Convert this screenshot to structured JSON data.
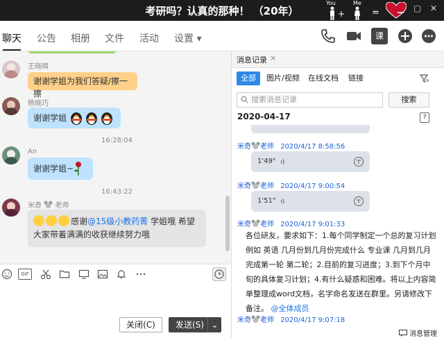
{
  "titlebar": {
    "title": "考研吗？认真的那种！ （20年）",
    "fig_you": "You",
    "fig_me": "Me",
    "plus": "+",
    "equals": "="
  },
  "tabs": [
    {
      "label": "聊天"
    },
    {
      "label": "公告"
    },
    {
      "label": "相册"
    },
    {
      "label": "文件"
    },
    {
      "label": "活动"
    },
    {
      "label": "设置 ▾"
    }
  ],
  "toolbar": {
    "course_label": "课"
  },
  "chat": {
    "messages": [
      {
        "sender": "王晓晴",
        "text": "谢谢学姐为我们答疑/擦一擦"
      },
      {
        "sender": "杨晓巧",
        "text": "谢谢学姐"
      },
      {
        "sender": "An",
        "text": "谢谢学姐~"
      },
      {
        "sender": "米奇",
        "sender_suffix": "老师",
        "text_prefix": "感谢",
        "mention": "@15级小教药菁",
        "text_after": " 学姐哦 希望大家带着满满的收获继续努力哦"
      }
    ],
    "times": [
      "16:28:04",
      "16:43:22"
    ]
  },
  "input": {
    "close_label": "关闭(C)",
    "send_label": "发送(S)",
    "send_caret": "⌄",
    "gif_label": "GIF"
  },
  "history": {
    "tab_title": "消息记录",
    "close_x": "×",
    "filters": [
      "全部",
      "图片/视频",
      "在线文档",
      "链接"
    ],
    "search_placeholder": "搜索消息记录",
    "search_button": "搜索",
    "date": "2020-04-17",
    "calendar_day": "7",
    "entries": [
      {
        "name": "米奇",
        "suffix": "老师",
        "time": "2020/4/17 8:58:56",
        "duration": "1'49\""
      },
      {
        "name": "米奇",
        "suffix": "老师",
        "time": "2020/4/17 9:00:54",
        "duration": "1'51\""
      },
      {
        "name": "米奇",
        "suffix": "老师",
        "time": "2020/4/17 9:01:33"
      },
      {
        "name": "米奇",
        "suffix": "老师",
        "time": "2020/4/17 9:07:18"
      }
    ],
    "long_text": "各位研友，要求如下：1.每个同学制定一个总的复习计划 例如 英语 几月份到几月份完成什么 专业课 几月到几月完成第一轮 第二轮；2.目前的复习进度；3.到下个月中旬的具体复习计划；4.有什么疑惑和困难。将以上内容简单整理成word文档，名字命名发送在群里。另请修改下备注。",
    "long_mention": "@全体成员",
    "bottom_label": "消息管理"
  },
  "colors": {
    "accent": "#2e89e6",
    "bubble_orange": "#ffd08a",
    "bubble_blue": "#bfe3ff",
    "name_blue": "#1a5fd8"
  }
}
